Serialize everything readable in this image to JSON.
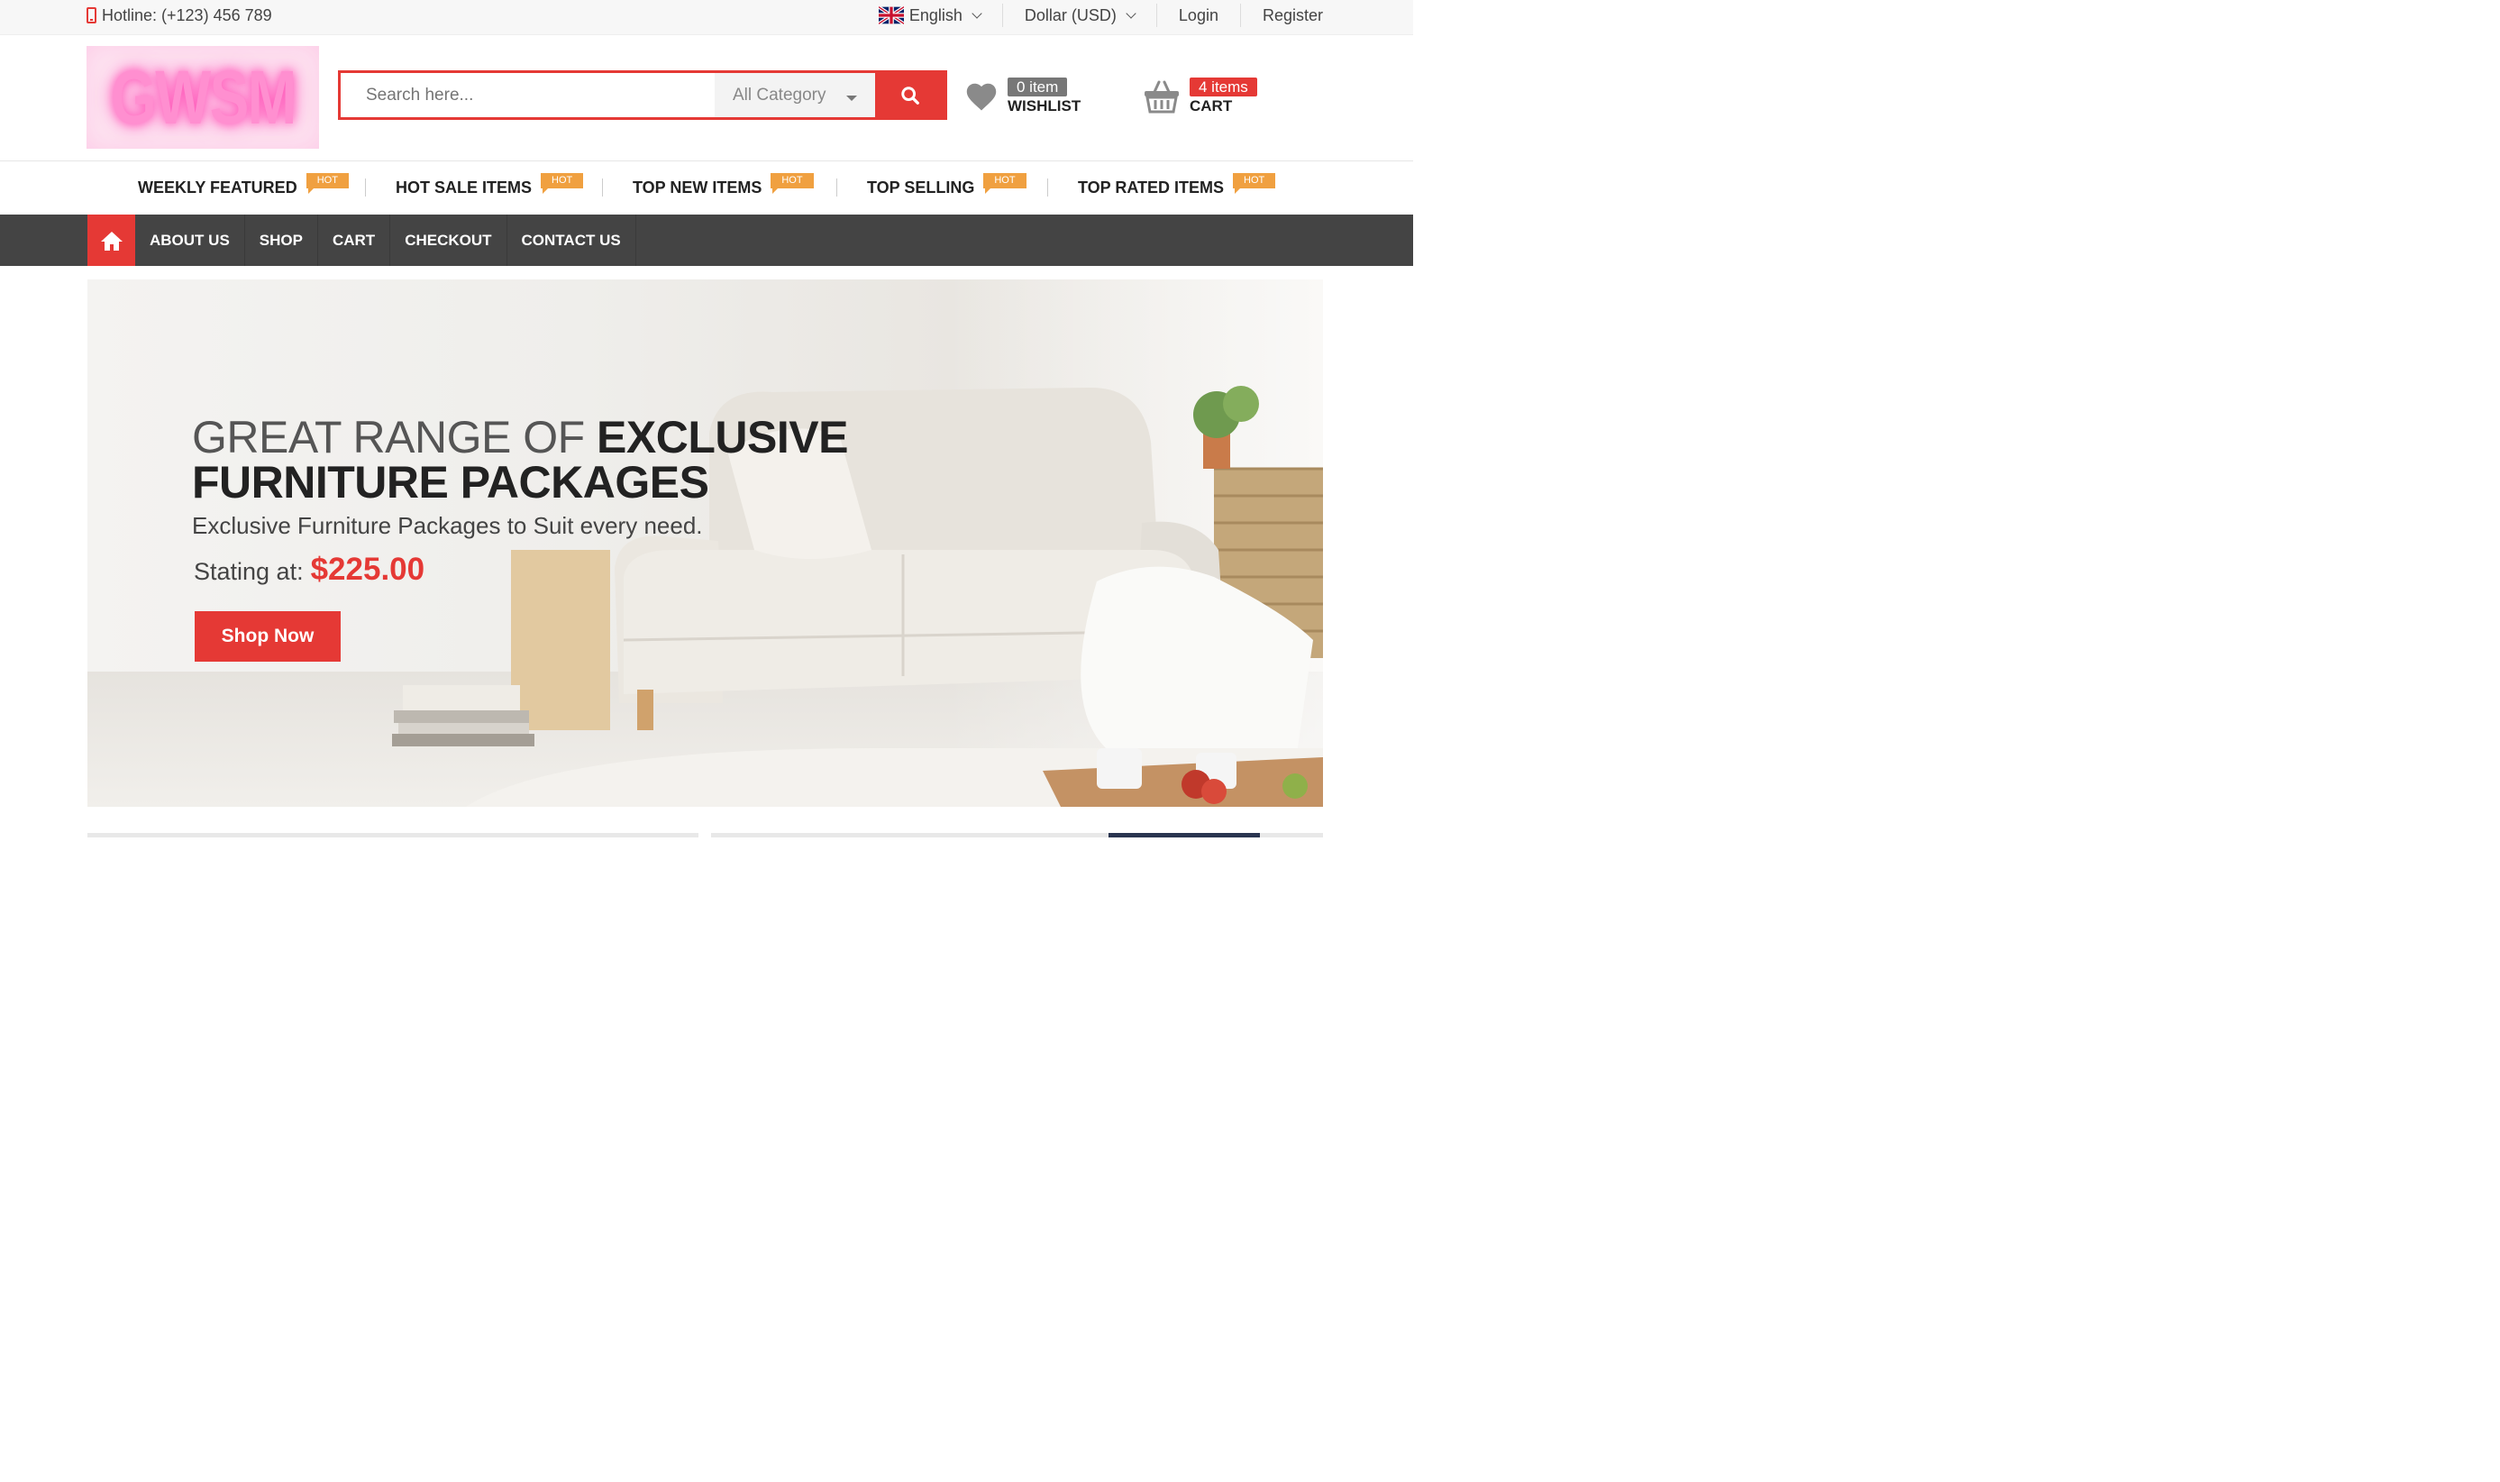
{
  "topbar": {
    "hotline": "Hotline: (+123) 456 789",
    "language": "English",
    "currency": "Dollar (USD)",
    "login": "Login",
    "register": "Register"
  },
  "header": {
    "logo_text": "GWSM",
    "search_placeholder": "Search here...",
    "category": "All Category",
    "wishlist": {
      "count": "0 item",
      "label": "WISHLIST"
    },
    "cart": {
      "count": "4 items",
      "label": "CART"
    }
  },
  "hot_items": [
    {
      "label": "WEEKLY FEATURED",
      "tag": "HOT"
    },
    {
      "label": "HOT SALE ITEMS",
      "tag": "HOT"
    },
    {
      "label": "TOP NEW ITEMS",
      "tag": "HOT"
    },
    {
      "label": "TOP SELLING",
      "tag": "HOT"
    },
    {
      "label": "TOP RATED ITEMS",
      "tag": "HOT"
    }
  ],
  "nav": {
    "items": [
      "ABOUT US",
      "SHOP",
      "CART",
      "CHECKOUT",
      "CONTACT US"
    ]
  },
  "hero": {
    "title_light": "GREAT RANGE OF ",
    "title_bold_1": "EXCLUSIVE",
    "title_bold_2": "FURNITURE PACKAGES",
    "subtitle": "Exclusive Furniture Packages to Suit every need.",
    "price_label": "Stating at:",
    "price": "$225.00",
    "button": "Shop Now"
  },
  "colors": {
    "accent": "#e53935",
    "hot_tag": "#f0a040",
    "nav_bg": "#444444"
  }
}
